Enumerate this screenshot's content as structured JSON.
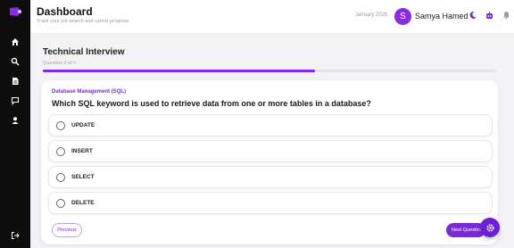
{
  "header": {
    "title": "Dashboard",
    "subtitle": "Track your job search and career progress",
    "date": "January 2026",
    "avatar_initial": "S",
    "username": "Samya Hamed"
  },
  "sidebar": {
    "items": [
      {
        "icon": "home-icon"
      },
      {
        "icon": "search-icon"
      },
      {
        "icon": "document-icon"
      },
      {
        "icon": "chat-icon"
      },
      {
        "icon": "user-icon"
      }
    ],
    "logout_icon": "logout-icon"
  },
  "interview": {
    "title": "Technical Interview",
    "progress_label": "Question 3 of 5",
    "progress_fraction": 0.6,
    "category": "Database Management (SQL)",
    "question": "Which SQL keyword is used to retrieve data from one or more tables in a database?",
    "options": [
      "UPDATE",
      "INSERT",
      "SELECT",
      "DELETE"
    ],
    "previous_label": "Previous",
    "next_label": "Next Question"
  },
  "colors": {
    "accent": "#7a2ad6",
    "sidebar": "#0d0d0d"
  }
}
